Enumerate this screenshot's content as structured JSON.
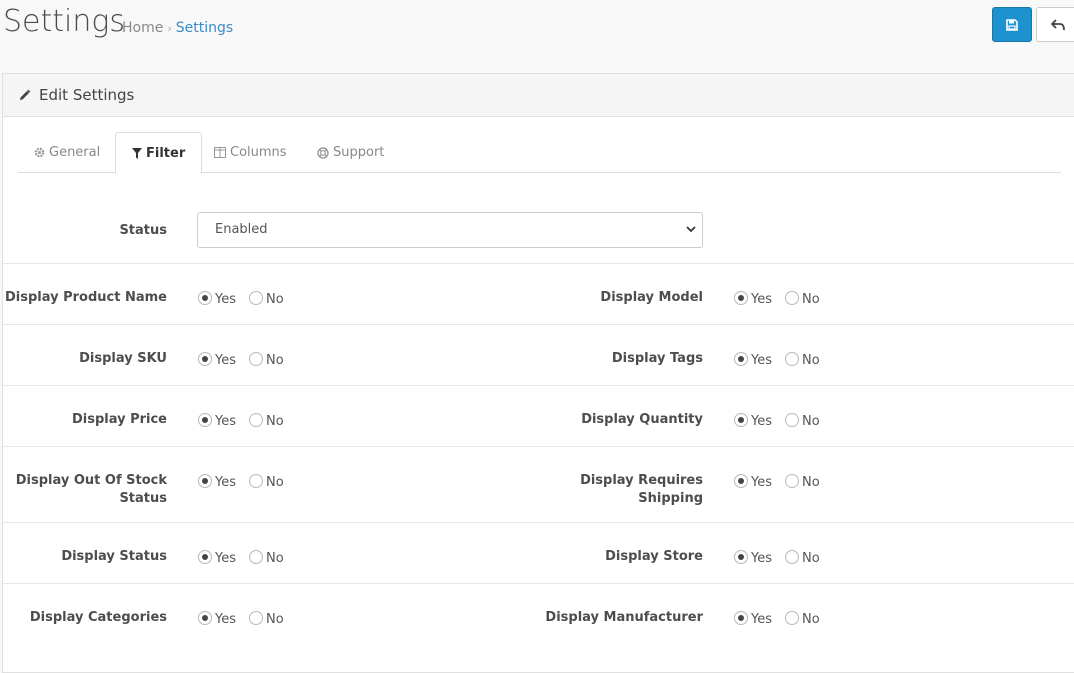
{
  "header": {
    "title": "Settings",
    "breadcrumb": {
      "home": "Home",
      "separator": "›",
      "current": "Settings"
    },
    "save_icon": "floppy-disk-icon",
    "back_icon": "reply-arrow-icon"
  },
  "panel": {
    "heading": "Edit Settings",
    "heading_icon": "pencil-icon"
  },
  "tabs": [
    {
      "label": "General",
      "icon": "gear-icon",
      "active": false
    },
    {
      "label": "Filter",
      "icon": "funnel-icon",
      "active": true
    },
    {
      "label": "Columns",
      "icon": "columns-icon",
      "active": false
    },
    {
      "label": "Support",
      "icon": "life-ring-icon",
      "active": false
    }
  ],
  "status": {
    "label": "Status",
    "value": "Enabled"
  },
  "radio_options": {
    "yes": "Yes",
    "no": "No"
  },
  "rows": [
    {
      "left": {
        "label": "Display Product Name",
        "value": "Yes"
      },
      "right": {
        "label": "Display Model",
        "value": "Yes"
      }
    },
    {
      "left": {
        "label": "Display SKU",
        "value": "Yes"
      },
      "right": {
        "label": "Display Tags",
        "value": "Yes"
      }
    },
    {
      "left": {
        "label": "Display Price",
        "value": "Yes"
      },
      "right": {
        "label": "Display Quantity",
        "value": "Yes"
      }
    },
    {
      "left": {
        "label_line1": "Display Out Of Stock",
        "label_line2": "Status",
        "value": "Yes"
      },
      "right": {
        "label_line1": "Display Requires",
        "label_line2": "Shipping",
        "value": "Yes"
      }
    },
    {
      "left": {
        "label": "Display Status",
        "value": "Yes"
      },
      "right": {
        "label": "Display Store",
        "value": "Yes"
      }
    },
    {
      "left": {
        "label": "Display Categories",
        "value": "Yes"
      },
      "right": {
        "label": "Display Manufacturer",
        "value": "Yes"
      }
    }
  ],
  "colors": {
    "primary": "#1e91cf",
    "link": "#3b8bc9"
  }
}
